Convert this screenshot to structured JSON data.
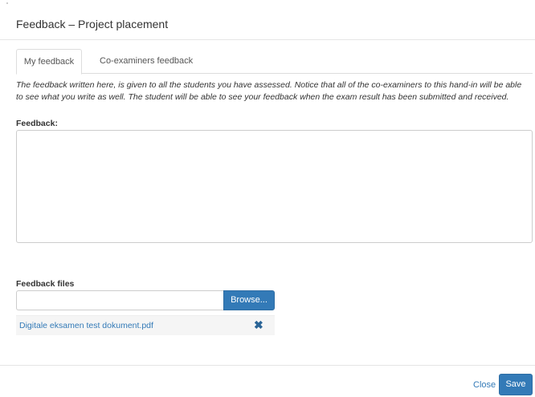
{
  "modal": {
    "title": "Feedback  –  Project placement"
  },
  "tabs": [
    {
      "label": "My feedback",
      "active": true
    },
    {
      "label": "Co-examiners feedback",
      "active": false
    }
  ],
  "description": "The feedback written here, is given to all the students you have assessed. Notice that all of the co-examiners to this hand-in will be able to see what you write as well. The student will be able to see your feedback when the exam result has been submitted and received.",
  "feedback": {
    "label": "Feedback:",
    "value": ""
  },
  "files": {
    "label": "Feedback files",
    "input_value": "",
    "browse_label": "Browse...",
    "items": [
      {
        "name": "Digitale eksamen test dokument.pdf",
        "remove_icon": "times-icon"
      }
    ]
  },
  "footer": {
    "close_label": "Close",
    "save_label": "Save"
  },
  "colors": {
    "primary": "#337ab7",
    "border": "#dddddd",
    "file_row_bg": "#f5f5f5"
  }
}
